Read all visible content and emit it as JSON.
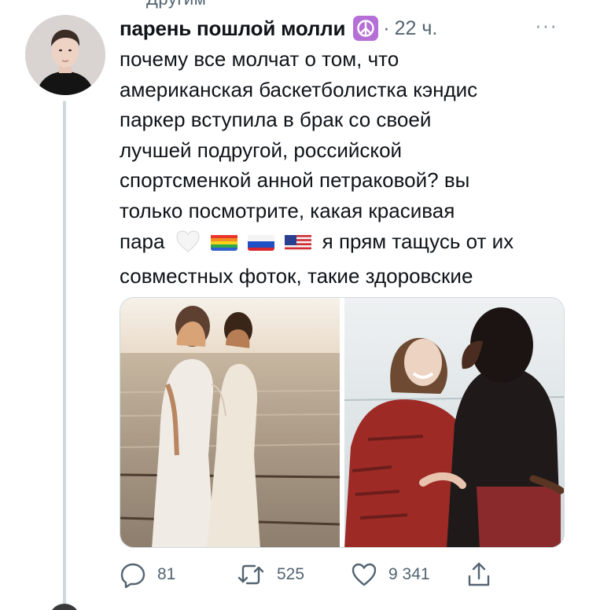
{
  "top_partial_text": "Другим",
  "tweet": {
    "display_name": "парень пошлой молли",
    "name_emoji": "peace-symbol-emoji",
    "separator": "·",
    "time": "22 ч.",
    "more": "···",
    "text_lines": [
      "почему все молчат о том, что",
      "американская баскетболистка кэндис",
      "паркер вступила в брак со своей",
      "лучшей подругой, российской",
      "спортсменкой анной петраковой? вы",
      "только посмотрите, какая красивая"
    ],
    "line7_start": "пара",
    "line7_emojis": [
      "white-heart-emoji",
      "rainbow-flag-emoji",
      "russia-flag-emoji",
      "usa-flag-emoji"
    ],
    "line7_end": "я прям тащусь от их",
    "line8": "совместных фоток, такие здоровские",
    "photos": [
      "wedding-photo",
      "hug-photo"
    ]
  },
  "actions": {
    "replies": "81",
    "retweets": "525",
    "likes": "9 341"
  },
  "colors": {
    "text": "#0f1419",
    "secondary": "#536471",
    "border": "#cfd9de",
    "thread_line": "#cfd9de"
  }
}
